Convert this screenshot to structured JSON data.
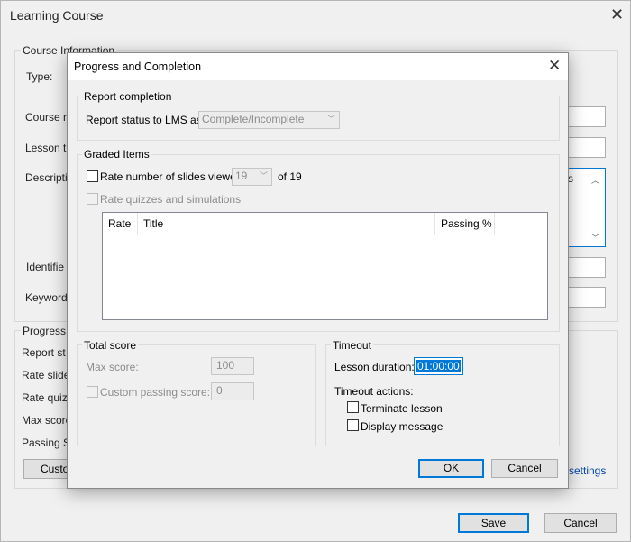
{
  "bg_window": {
    "title": "Learning Course",
    "course_info_label": "Course Information",
    "type_label": "Type:",
    "course_name_label": "Course n",
    "lesson_title_label": "Lesson ti",
    "description_label": "Descriptio",
    "description_text": "s",
    "identifier_label": "Identifie",
    "keywords_label": "Keyword",
    "progress_label": "Progress",
    "report_status_label": "Report st",
    "rate_slides_label": "Rate slide",
    "rate_quizzes_label": "Rate quiz",
    "max_score_label": "Max score",
    "passing_score_label": "Passing Sc",
    "customize_button": "Custo",
    "settings_link": "settings",
    "save_button": "Save",
    "cancel_button": "Cancel"
  },
  "dialog": {
    "title": "Progress and Completion",
    "report_completion": {
      "group_label": "Report completion",
      "status_label": "Report status to LMS as:",
      "status_value": "Complete/Incomplete"
    },
    "graded_items": {
      "group_label": "Graded Items",
      "rate_slides_label": "Rate number of slides viewed:",
      "slides_value": "19",
      "of_total": "of 19",
      "rate_quizzes_label": "Rate quizzes and simulations",
      "columns": [
        "Rate",
        "Title",
        "Passing %"
      ]
    },
    "total_score": {
      "group_label": "Total score",
      "max_score_label": "Max score:",
      "max_score_value": "100",
      "custom_passing_label": "Custom passing score:",
      "custom_passing_value": "0"
    },
    "timeout": {
      "group_label": "Timeout",
      "duration_label": "Lesson duration:",
      "duration_value": "01:00:00",
      "actions_label": "Timeout actions:",
      "terminate_label": "Terminate lesson",
      "display_message_label": "Display message"
    },
    "ok_button": "OK",
    "cancel_button": "Cancel"
  }
}
